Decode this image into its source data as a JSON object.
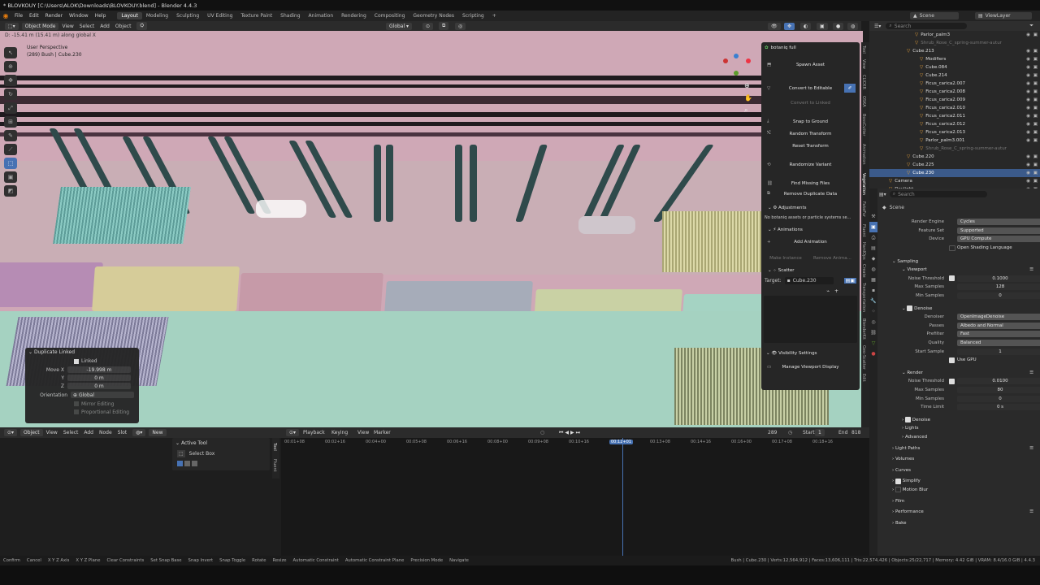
{
  "window_title": "* BLOVKOUY [C:\\Users\\ALOK\\Downloads\\BLOVKOUY.blend] - Blender 4.4.3",
  "menu": [
    "File",
    "Edit",
    "Render",
    "Window",
    "Help"
  ],
  "workspaces": [
    "Layout",
    "Modeling",
    "Sculpting",
    "UV Editing",
    "Texture Paint",
    "Shading",
    "Animation",
    "Rendering",
    "Compositing",
    "Geometry Nodes",
    "Scripting"
  ],
  "scene": {
    "label": "Scene",
    "viewlayer": "ViewLayer"
  },
  "viewport_header": {
    "mode": "Object Mode",
    "view": "View",
    "select": "Select",
    "add": "Add",
    "object": "Object",
    "orientation": "Global"
  },
  "viewport": {
    "status": "D: -15.41 m (15.41 m) along global X",
    "perspective": "User Perspective",
    "info": "(289) Bush | Cube.230"
  },
  "npanel": {
    "title": "botaniq full",
    "spawn": "Spawn Asset",
    "convert": "Convert to Editable",
    "convert_linked": "Convert to Linked",
    "snap": "Snap to Ground",
    "random_transform": "Random Transform",
    "reset_transform": "Reset Transform",
    "randomize_variant": "Randomize Variant",
    "find_missing": "Find Missing Files",
    "remove_dup": "Remove Duplicate Data",
    "adjustments": "Adjustments",
    "adjustments_msg": "No botaniq assets or particle systems se...",
    "animations": "Animations",
    "add_anim": "Add Animation",
    "make_instance": "Make Instance",
    "remove_anim": "Remove Anima...",
    "scatter": "Scatter",
    "target_label": "Target:",
    "target_value": "Cube.230",
    "visibility": "Visibility Settings",
    "manage": "Manage Viewport Display"
  },
  "vtabs": [
    "Tool",
    "View",
    "CLICKR",
    "OSKA",
    "BossCutter",
    "Animation",
    "Vegetation",
    "FakeFur",
    "Fluent",
    "HardOps",
    "Create",
    "Transportation",
    "BlenderKit",
    "Geo-Scatter",
    "Edit"
  ],
  "duplicate": {
    "title": "Duplicate Linked",
    "linked": "Linked",
    "move_x_label": "Move X",
    "move_x": "-19.998 m",
    "y_label": "Y",
    "y": "0 m",
    "z_label": "Z",
    "z": "0 m",
    "orient_label": "Orientation",
    "orient": "Global",
    "mirror": "Mirror Editing",
    "prop": "Proportional Editing"
  },
  "tl_header": {
    "object": "Object",
    "view": "View",
    "select": "Select",
    "add": "Add",
    "node": "Node",
    "slot": "Slot",
    "new": "New",
    "playback": "Playback",
    "keying": "Keying",
    "view2": "View",
    "marker": "Marker",
    "frame": "289",
    "start_label": "Start",
    "start": "1",
    "end_label": "End",
    "end": "818"
  },
  "active_tool": {
    "title": "Active Tool",
    "tool": "Select Box"
  },
  "tl_ticks": [
    "00:01+08",
    "00:02+16",
    "00:04+00",
    "00:05+08",
    "00:06+16",
    "00:08+00",
    "00:09+08",
    "00:10+16",
    "00:12+01",
    "00:13+08",
    "00:14+16",
    "00:16+00",
    "00:17+08",
    "00:18+16"
  ],
  "outliner": {
    "search": "Search",
    "rows": [
      {
        "name": "Parlor_palm3",
        "dim": false,
        "sel": false,
        "indent": 56
      },
      {
        "name": "Shrub_Rose_C_spring-summer-autur",
        "dim": true,
        "sel": false,
        "indent": 56
      },
      {
        "name": "Cube.213",
        "dim": false,
        "sel": false,
        "indent": 46
      },
      {
        "name": "Modifiers",
        "dim": false,
        "sel": false,
        "indent": 62
      },
      {
        "name": "Cube.084",
        "dim": false,
        "sel": false,
        "indent": 62
      },
      {
        "name": "Cube.214",
        "dim": false,
        "sel": false,
        "indent": 62
      },
      {
        "name": "Ficus_carica2.007",
        "dim": false,
        "sel": false,
        "indent": 62
      },
      {
        "name": "Ficus_carica2.008",
        "dim": false,
        "sel": false,
        "indent": 62
      },
      {
        "name": "Ficus_carica2.009",
        "dim": false,
        "sel": false,
        "indent": 62
      },
      {
        "name": "Ficus_carica2.010",
        "dim": false,
        "sel": false,
        "indent": 62
      },
      {
        "name": "Ficus_carica2.011",
        "dim": false,
        "sel": false,
        "indent": 62
      },
      {
        "name": "Ficus_carica2.012",
        "dim": false,
        "sel": false,
        "indent": 62
      },
      {
        "name": "Ficus_carica2.013",
        "dim": false,
        "sel": false,
        "indent": 62
      },
      {
        "name": "Parlor_palm3.001",
        "dim": false,
        "sel": false,
        "indent": 62
      },
      {
        "name": "Shrub_Rose_C_spring-summer-autur",
        "dim": true,
        "sel": false,
        "indent": 62
      },
      {
        "name": "Cube.220",
        "dim": false,
        "sel": false,
        "indent": 46
      },
      {
        "name": "Cube.225",
        "dim": false,
        "sel": false,
        "indent": 46
      },
      {
        "name": "Cube.230",
        "dim": false,
        "sel": true,
        "indent": 46
      },
      {
        "name": "Camera",
        "dim": false,
        "sel": false,
        "indent": 24
      },
      {
        "name": "Daylight",
        "dim": false,
        "sel": false,
        "indent": 24
      }
    ]
  },
  "props": {
    "search": "Search",
    "scene": "Scene",
    "render_engine_label": "Render Engine",
    "render_engine": "Cycles",
    "feature_set_label": "Feature Set",
    "feature_set": "Supported",
    "device_label": "Device",
    "device": "GPU Compute",
    "osl": "Open Shading Language",
    "sampling": "Sampling",
    "viewport": "Viewport",
    "noise_threshold_label": "Noise Threshold",
    "noise_threshold": "0.1000",
    "max_samples_label": "Max Samples",
    "max_samples": "128",
    "min_samples_label": "Min Samples",
    "min_samples": "0",
    "denoise": "Denoise",
    "denoiser_label": "Denoiser",
    "denoiser": "OpenImageDenoise",
    "passes_label": "Passes",
    "passes": "Albedo and Normal",
    "prefilter_label": "Prefilter",
    "prefilter": "Fast",
    "quality_label": "Quality",
    "quality": "Balanced",
    "start_sample_label": "Start Sample",
    "start_sample": "1",
    "use_gpu": "Use GPU",
    "render": "Render",
    "r_noise_threshold": "0.0100",
    "r_max_samples": "80",
    "r_min_samples": "0",
    "time_limit_label": "Time Limit",
    "time_limit": "0 s",
    "denoise2": "Denoise",
    "lights": "Lights",
    "advanced": "Advanced",
    "light_paths": "Light Paths",
    "volumes": "Volumes",
    "curves": "Curves",
    "simplify": "Simplify",
    "motion_blur": "Motion Blur",
    "film": "Film",
    "performance": "Performance",
    "bake": "Bake"
  },
  "statusbar": [
    "Confirm",
    "Cancel",
    "X Y Z Axis",
    "X Y Z Plane",
    "Clear Constraints",
    "Set Snap Base",
    "Snap Invert",
    "Snap Toggle",
    "Rotate",
    "Resize",
    "Automatic Constraint",
    "Automatic Constraint Plane",
    "Precision Mode",
    "Navigate"
  ],
  "stats": "Bush | Cube.230 | Verts:12,564,912 | Faces:13,606,111 | Tris:22,574,426 | Objects:25/22,717 | Memory: 4.42 GiB | VRAM: 8.4/16.0 GiB | 4.4.3"
}
